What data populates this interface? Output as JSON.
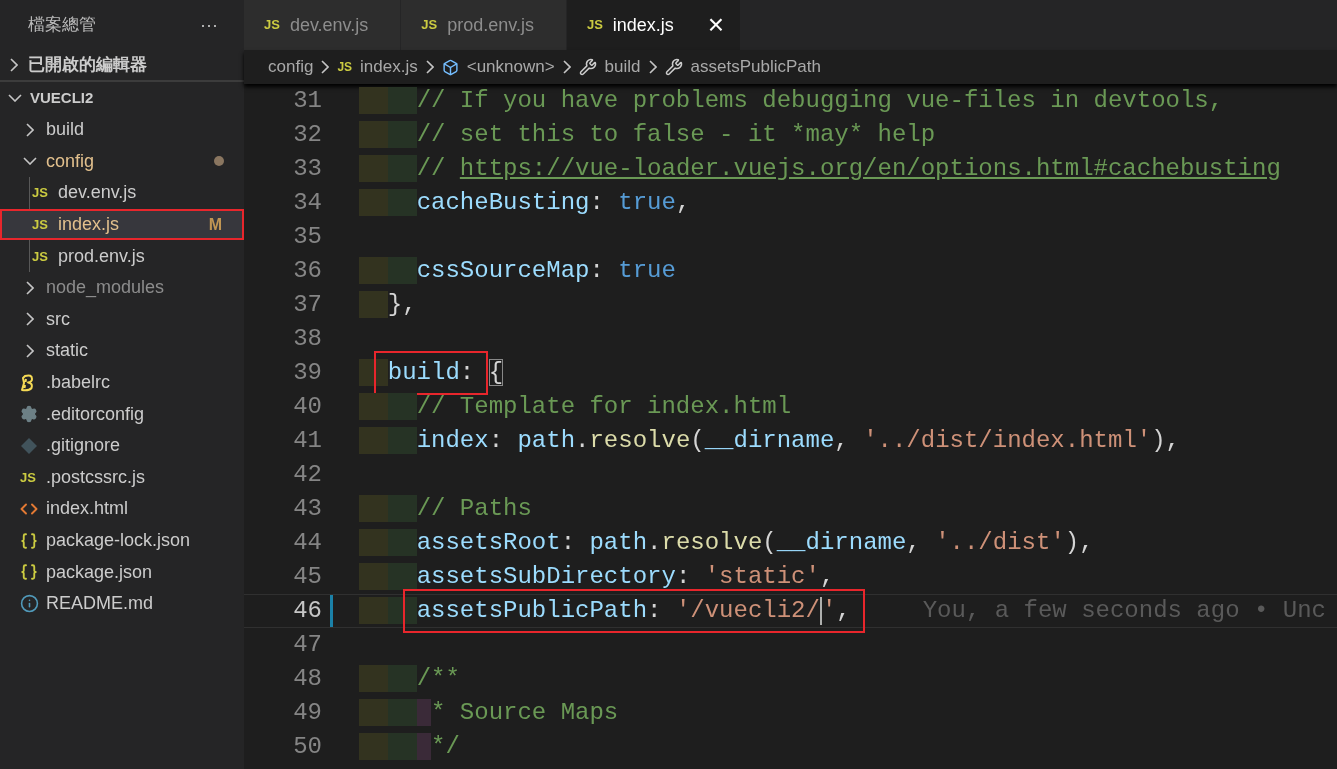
{
  "sidebar": {
    "title": "檔案總管",
    "more": "···",
    "sections": [
      {
        "label": "已開啟的編輯器",
        "expanded": false
      }
    ],
    "project": {
      "label": "VUECLI2",
      "expanded": true,
      "items": [
        {
          "name": "build",
          "kind": "folder",
          "expanded": false,
          "selected": false,
          "ignored": false,
          "changed": false,
          "boxed": false
        },
        {
          "name": "config",
          "kind": "folder",
          "expanded": true,
          "selected": false,
          "ignored": false,
          "changed": true,
          "boxed": false,
          "children": [
            {
              "name": "dev.env.js",
              "kind": "js",
              "icon_text": "JS",
              "selected": false,
              "ignored": false,
              "changed": false,
              "boxed": false
            },
            {
              "name": "index.js",
              "kind": "js",
              "icon_text": "JS",
              "selected": true,
              "ignored": false,
              "changed": true,
              "boxed": true,
              "git_status": "M"
            },
            {
              "name": "prod.env.js",
              "kind": "js",
              "icon_text": "JS",
              "selected": false,
              "ignored": false,
              "changed": false,
              "boxed": false
            }
          ]
        },
        {
          "name": "node_modules",
          "kind": "folder",
          "expanded": false,
          "selected": false,
          "ignored": true,
          "changed": false,
          "boxed": false
        },
        {
          "name": "src",
          "kind": "folder",
          "expanded": false,
          "selected": false,
          "ignored": false,
          "changed": false,
          "boxed": false
        },
        {
          "name": "static",
          "kind": "folder",
          "expanded": false,
          "selected": false,
          "ignored": false,
          "changed": false,
          "boxed": false
        },
        {
          "name": ".babelrc",
          "kind": "babel",
          "selected": false,
          "ignored": false,
          "changed": false,
          "boxed": false
        },
        {
          "name": ".editorconfig",
          "kind": "config",
          "selected": false,
          "ignored": false,
          "changed": false,
          "boxed": false
        },
        {
          "name": ".gitignore",
          "kind": "git",
          "selected": false,
          "ignored": false,
          "changed": false,
          "boxed": false
        },
        {
          "name": ".postcssrc.js",
          "kind": "js",
          "icon_text": "JS",
          "selected": false,
          "ignored": false,
          "changed": false,
          "boxed": false
        },
        {
          "name": "index.html",
          "kind": "html",
          "selected": false,
          "ignored": false,
          "changed": false,
          "boxed": false
        },
        {
          "name": "package-lock.json",
          "kind": "json",
          "selected": false,
          "ignored": false,
          "changed": false,
          "boxed": false
        },
        {
          "name": "package.json",
          "kind": "json",
          "selected": false,
          "ignored": false,
          "changed": false,
          "boxed": false
        },
        {
          "name": "README.md",
          "kind": "markdown",
          "selected": false,
          "ignored": false,
          "changed": false,
          "boxed": false
        }
      ]
    }
  },
  "tabs": [
    {
      "icon_text": "JS",
      "label": "dev.env.js",
      "selected": false
    },
    {
      "icon_text": "JS",
      "label": "prod.env.js",
      "selected": false
    },
    {
      "icon_text": "JS",
      "label": "index.js",
      "selected": true,
      "close": "×"
    }
  ],
  "breadcrumbs": [
    {
      "label": "config",
      "kind": "folder"
    },
    {
      "label": "index.js",
      "kind": "js",
      "icon_text": "JS"
    },
    {
      "label": "<unknown>",
      "kind": "module"
    },
    {
      "label": "build",
      "kind": "property"
    },
    {
      "label": "assetsPublicPath",
      "kind": "property"
    }
  ],
  "editor": {
    "lines": [
      {
        "number": "31",
        "current": false,
        "modified": false,
        "tokens": [
          {
            "kind": "comment",
            "text": "    // If you have problems debugging vue-files in devtools,"
          }
        ]
      },
      {
        "number": "32",
        "current": false,
        "modified": false,
        "tokens": [
          {
            "kind": "comment",
            "text": "    // set this to false - it *may* help"
          }
        ]
      },
      {
        "number": "33",
        "current": false,
        "modified": false,
        "tokens": [
          {
            "kind": "comment",
            "text": "    // "
          },
          {
            "kind": "link",
            "text": "https://vue-loader.vuejs.org/en/options.html#cachebusting"
          }
        ]
      },
      {
        "number": "34",
        "current": false,
        "modified": false,
        "tokens": [
          {
            "kind": "key",
            "text": "    cacheBusting"
          },
          {
            "kind": "punct",
            "text": ": "
          },
          {
            "kind": "bool",
            "text": "true"
          },
          {
            "kind": "punct",
            "text": ","
          }
        ]
      },
      {
        "number": "35",
        "current": false,
        "modified": false
      },
      {
        "number": "36",
        "current": false,
        "modified": false,
        "tokens": [
          {
            "kind": "key",
            "text": "    cssSourceMap"
          },
          {
            "kind": "punct",
            "text": ": "
          },
          {
            "kind": "bool",
            "text": "true"
          }
        ]
      },
      {
        "number": "37",
        "current": false,
        "modified": false,
        "tokens": [
          {
            "kind": "punct",
            "text": "  },"
          }
        ]
      },
      {
        "number": "38",
        "current": false,
        "modified": false
      },
      {
        "number": "39",
        "current": false,
        "modified": false,
        "tokens": [
          {
            "kind": "highlight",
            "tokens": [
              {
                "kind": "key",
                "text": "  build"
              },
              {
                "kind": "punct",
                "text": ":"
              }
            ]
          },
          {
            "kind": "bracket",
            "text": " {"
          }
        ]
      },
      {
        "number": "40",
        "current": false,
        "modified": false,
        "tokens": [
          {
            "kind": "comment",
            "text": "    // Template for index.html"
          }
        ]
      },
      {
        "number": "41",
        "current": false,
        "modified": false,
        "tokens": [
          {
            "kind": "key",
            "text": "    index"
          },
          {
            "kind": "punct",
            "text": ": "
          },
          {
            "kind": "var",
            "text": "path"
          },
          {
            "kind": "punct",
            "text": "."
          },
          {
            "kind": "fn",
            "text": "resolve"
          },
          {
            "kind": "punct",
            "text": "("
          },
          {
            "kind": "var",
            "text": "__dirname"
          },
          {
            "kind": "punct",
            "text": ", "
          },
          {
            "kind": "string",
            "text": "'../dist/index.html'"
          },
          {
            "kind": "punct",
            "text": "),"
          }
        ]
      },
      {
        "number": "42",
        "current": false,
        "modified": false
      },
      {
        "number": "43",
        "current": false,
        "modified": false,
        "tokens": [
          {
            "kind": "comment",
            "text": "    // Paths"
          }
        ]
      },
      {
        "number": "44",
        "current": false,
        "modified": false,
        "tokens": [
          {
            "kind": "key",
            "text": "    assetsRoot"
          },
          {
            "kind": "punct",
            "text": ": "
          },
          {
            "kind": "var",
            "text": "path"
          },
          {
            "kind": "punct",
            "text": "."
          },
          {
            "kind": "fn",
            "text": "resolve"
          },
          {
            "kind": "punct",
            "text": "("
          },
          {
            "kind": "var",
            "text": "__dirname"
          },
          {
            "kind": "punct",
            "text": ", "
          },
          {
            "kind": "string",
            "text": "'../dist'"
          },
          {
            "kind": "punct",
            "text": "),"
          }
        ]
      },
      {
        "number": "45",
        "current": false,
        "modified": false,
        "tokens": [
          {
            "kind": "key",
            "text": "    assetsSubDirectory"
          },
          {
            "kind": "punct",
            "text": ": "
          },
          {
            "kind": "string",
            "text": "'static'"
          },
          {
            "kind": "punct",
            "text": ","
          }
        ]
      },
      {
        "number": "46",
        "current": true,
        "modified": true,
        "blame": "You, a few seconds ago • Unc",
        "tokens": [
          {
            "kind": "highlight",
            "tokens": [
              {
                "kind": "key",
                "text": "    assetsPublicPath"
              },
              {
                "kind": "punct",
                "text": ": "
              },
              {
                "kind": "string",
                "text": "'/vuecli2/"
              },
              {
                "kind": "cursor"
              },
              {
                "kind": "string",
                "text": "'"
              },
              {
                "kind": "punct",
                "text": ","
              }
            ]
          }
        ]
      },
      {
        "number": "47",
        "current": false,
        "modified": false
      },
      {
        "number": "48",
        "current": false,
        "modified": false,
        "tokens": [
          {
            "kind": "comment",
            "text": "    /**"
          }
        ]
      },
      {
        "number": "49",
        "current": false,
        "modified": false,
        "tokens": [
          {
            "kind": "comment",
            "text": "     * Source Maps"
          }
        ]
      },
      {
        "number": "50",
        "current": false,
        "modified": false,
        "tokens": [
          {
            "kind": "comment",
            "text": "     */"
          }
        ]
      }
    ]
  }
}
